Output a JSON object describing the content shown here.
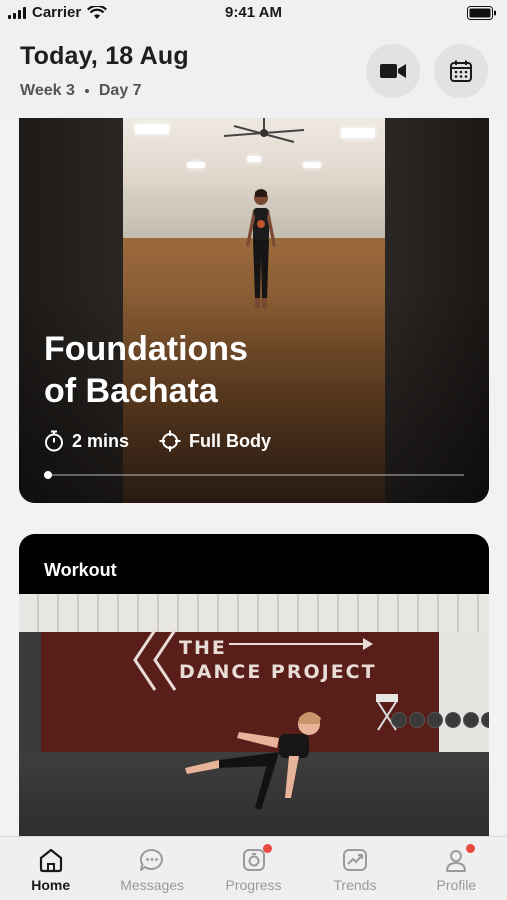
{
  "status_bar": {
    "carrier": "Carrier",
    "time": "9:41 AM"
  },
  "header": {
    "date_title": "Today, 18 Aug",
    "week": "Week 3",
    "day": "Day 7",
    "video_icon": "video-camera-icon",
    "calendar_icon": "calendar-icon"
  },
  "featured_card": {
    "title_line1": "Foundations",
    "title_line2": "of Bachata",
    "duration": "2 mins",
    "focus": "Full Body",
    "progress": 0.0
  },
  "workout_card": {
    "label": "Workout",
    "logo_line1": "THE",
    "logo_line2": "DANCE PROJECT"
  },
  "tabs": [
    {
      "label": "Home",
      "icon": "home-icon",
      "active": true,
      "badge": false
    },
    {
      "label": "Messages",
      "icon": "chat-bubble-icon",
      "active": false,
      "badge": false
    },
    {
      "label": "Progress",
      "icon": "progress-icon",
      "active": false,
      "badge": true
    },
    {
      "label": "Trends",
      "icon": "trend-chart-icon",
      "active": false,
      "badge": false
    },
    {
      "label": "Profile",
      "icon": "user-icon",
      "active": false,
      "badge": true
    }
  ],
  "colors": {
    "badge": "#e84a3f",
    "background": "#f2f2f2",
    "card_dark": "#000000"
  }
}
